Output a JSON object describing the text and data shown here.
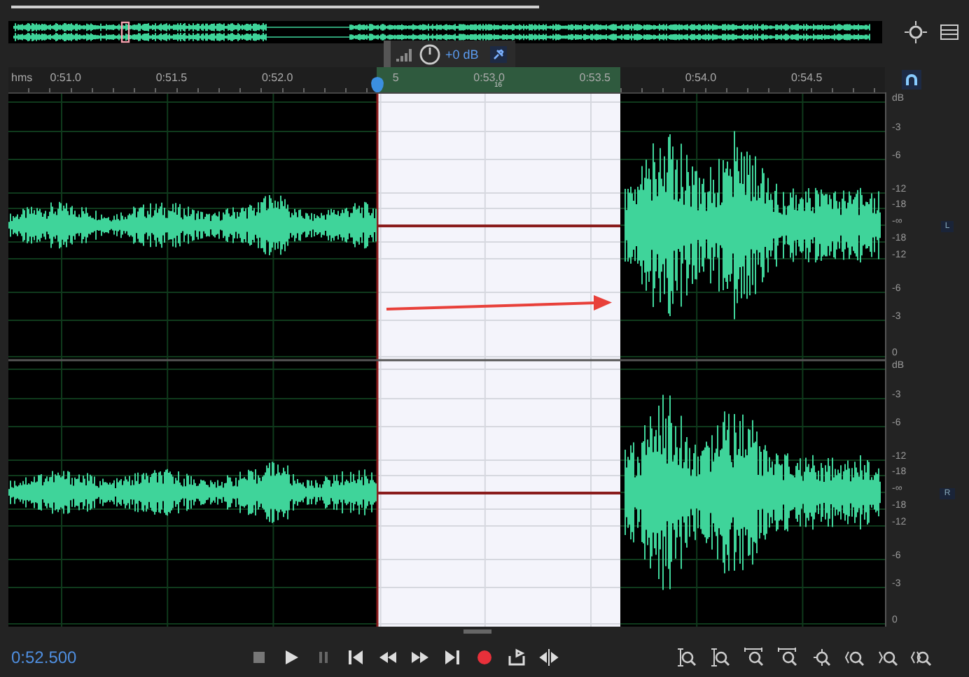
{
  "hud": {
    "gain": "+0 dB"
  },
  "ruler": {
    "unit": "hms",
    "labels": [
      "0:51.0",
      "0:51.5",
      "0:52.0",
      "5",
      "0:53.0",
      "0:53.5",
      "0:54.0",
      "0:54.5"
    ],
    "sub_label": "16"
  },
  "channels": [
    {
      "label": "L",
      "db_scale": [
        "dB",
        "-3",
        "-6",
        "-12",
        "-18",
        "-∞",
        "-18",
        "-12",
        "-6",
        "-3",
        "0"
      ]
    },
    {
      "label": "R",
      "db_scale": [
        "dB",
        "-3",
        "-6",
        "-12",
        "-18",
        "-∞",
        "-18",
        "-12",
        "-6",
        "-3",
        "0"
      ]
    }
  ],
  "transport": {
    "time": "0:52.500"
  }
}
